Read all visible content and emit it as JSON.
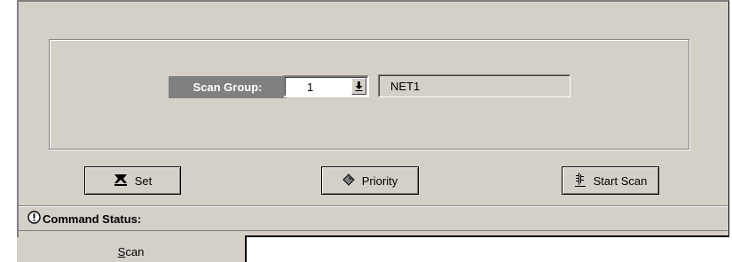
{
  "scan_group": {
    "label": "Scan Group:",
    "selected_value": "1",
    "network_name": "NET1"
  },
  "buttons": {
    "set": "Set",
    "priority": "Priority",
    "start_scan": "Start Scan"
  },
  "status": {
    "label": "Command Status:"
  },
  "tabs": {
    "scan": "Scan"
  },
  "icons": {
    "set": "set-icon",
    "priority": "diamond-icon",
    "start_scan": "scan-icon",
    "status": "exclamation-icon",
    "dropdown": "dropdown-arrow-icon"
  },
  "colors": {
    "panel_bg": "#d4d0c8",
    "label_bg": "#808080"
  }
}
